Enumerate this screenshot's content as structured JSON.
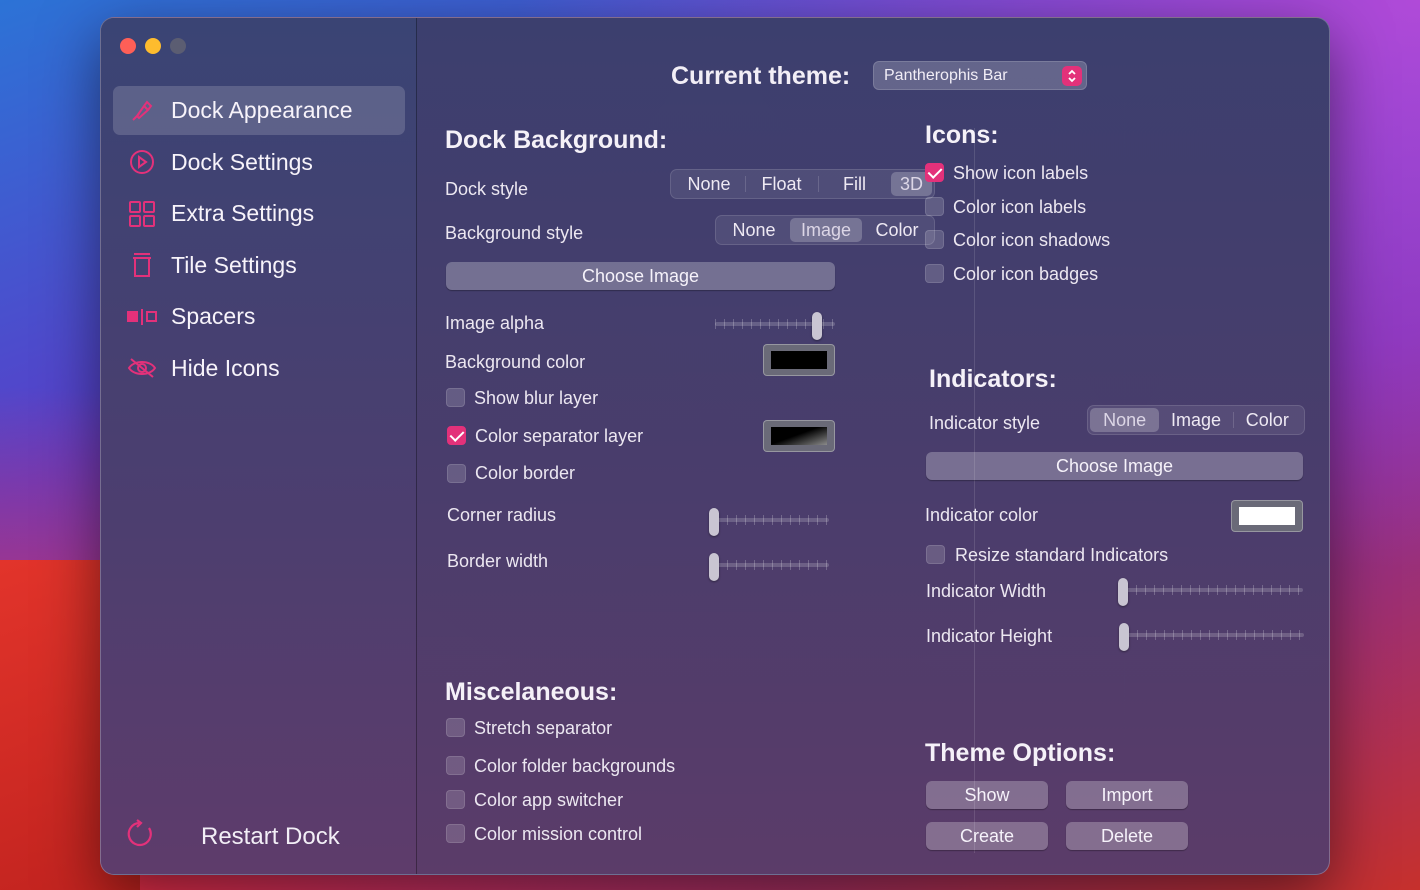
{
  "sidebar": {
    "items": [
      {
        "label": "Dock Appearance",
        "icon": "paintbrush-icon",
        "active": true
      },
      {
        "label": "Dock Settings",
        "icon": "dock-settings-icon"
      },
      {
        "label": "Extra Settings",
        "icon": "grid-icon"
      },
      {
        "label": "Tile Settings",
        "icon": "trash-icon"
      },
      {
        "label": "Spacers",
        "icon": "spacers-icon"
      },
      {
        "label": "Hide Icons",
        "icon": "eye-slash-icon"
      }
    ],
    "restart_label": "Restart Dock"
  },
  "header": {
    "current_theme_label": "Current theme:",
    "current_theme_value": "Pantherophis Bar"
  },
  "dock_background": {
    "title": "Dock Background:",
    "dock_style_label": "Dock style",
    "dock_style_options": [
      "None",
      "Float",
      "Fill",
      "3D"
    ],
    "dock_style_selected": "3D",
    "background_style_label": "Background style",
    "background_style_options": [
      "None",
      "Image",
      "Color"
    ],
    "background_style_selected": "Image",
    "choose_image_label": "Choose Image",
    "image_alpha_label": "Image alpha",
    "image_alpha_value": 0.87,
    "background_color_label": "Background color",
    "show_blur_layer_label": "Show blur layer",
    "color_separator_layer_label": "Color separator layer",
    "color_border_label": "Color border",
    "corner_radius_label": "Corner radius",
    "corner_radius_value": 0,
    "border_width_label": "Border width",
    "border_width_value": 0
  },
  "misc": {
    "title": "Miscelaneous:",
    "stretch_separator_label": "Stretch separator",
    "color_folder_backgrounds_label": "Color folder backgrounds",
    "color_app_switcher_label": "Color app switcher",
    "color_mission_control_label": "Color mission control"
  },
  "icons": {
    "title": "Icons:",
    "show_icon_labels_label": "Show icon labels",
    "color_icon_labels_label": "Color icon labels",
    "color_icon_shadows_label": "Color icon shadows",
    "color_icon_badges_label": "Color icon badges"
  },
  "indicators": {
    "title": "Indicators:",
    "indicator_style_label": "Indicator style",
    "indicator_style_options": [
      "None",
      "Image",
      "Color"
    ],
    "indicator_style_selected": "None",
    "choose_image_label": "Choose Image",
    "indicator_color_label": "Indicator color",
    "resize_label": "Resize standard Indicators",
    "width_label": "Indicator Width",
    "width_value": 0,
    "height_label": "Indicator Height",
    "height_value": 0
  },
  "theme_options": {
    "title": "Theme Options:",
    "show_label": "Show",
    "import_label": "Import",
    "create_label": "Create",
    "delete_label": "Delete"
  },
  "colors": {
    "accent": "#e3317a",
    "background_color_swatch": "#000000",
    "indicator_color_swatch": "#ffffff"
  }
}
